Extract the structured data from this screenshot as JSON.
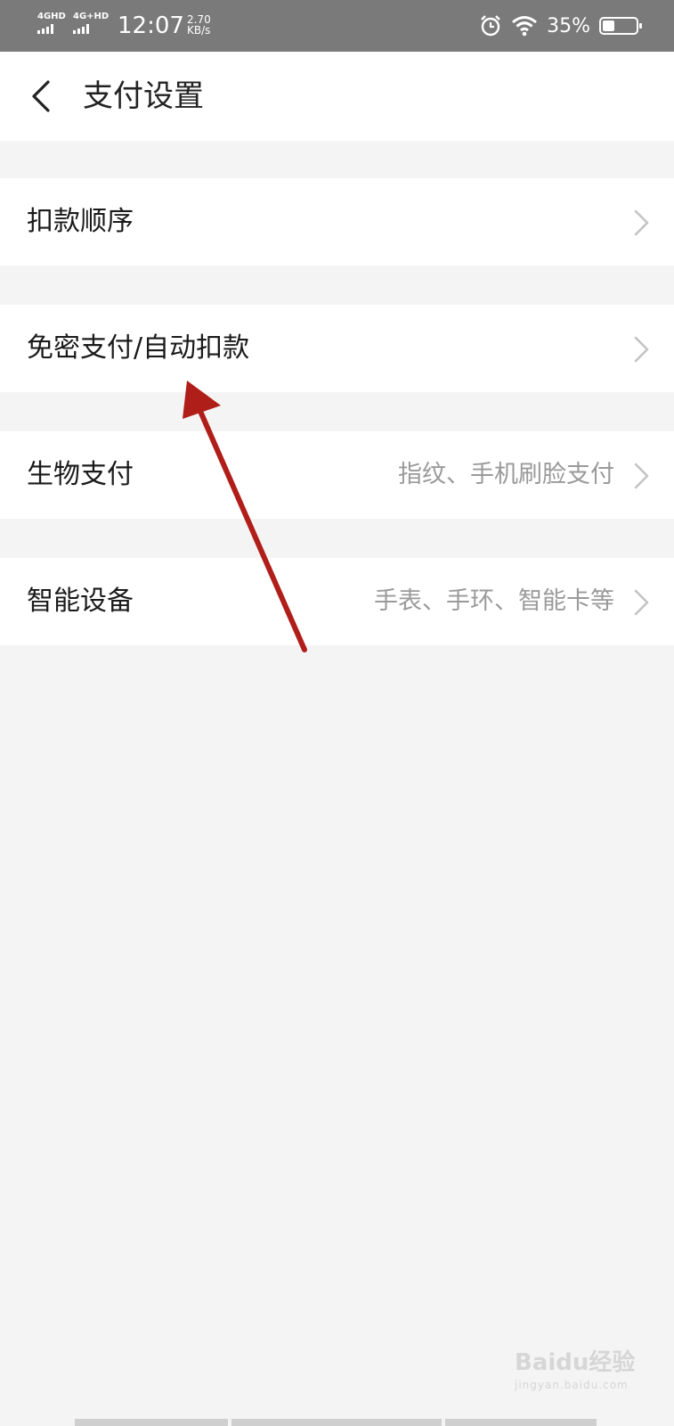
{
  "status_bar": {
    "sim1": "4GHD",
    "sim2": "4G+HD",
    "time": "12:07",
    "speed_value": "2.70",
    "speed_unit": "KB/s",
    "battery_percent": "35%",
    "battery_level": 0.35,
    "icons": [
      "alarm-icon",
      "wifi-icon",
      "battery-icon"
    ]
  },
  "header": {
    "back_icon": "chevron-left-icon",
    "title": "支付设置"
  },
  "settings": [
    {
      "label": "扣款顺序",
      "hint": ""
    },
    {
      "label": "免密支付/自动扣款",
      "hint": ""
    },
    {
      "label": "生物支付",
      "hint": "指纹、手机刷脸支付"
    },
    {
      "label": "智能设备",
      "hint": "手表、手环、智能卡等"
    }
  ],
  "annotation": {
    "color": "#b01e1a"
  },
  "watermark": {
    "brand": "Baidu经验",
    "url": "jingyan.baidu.com"
  }
}
